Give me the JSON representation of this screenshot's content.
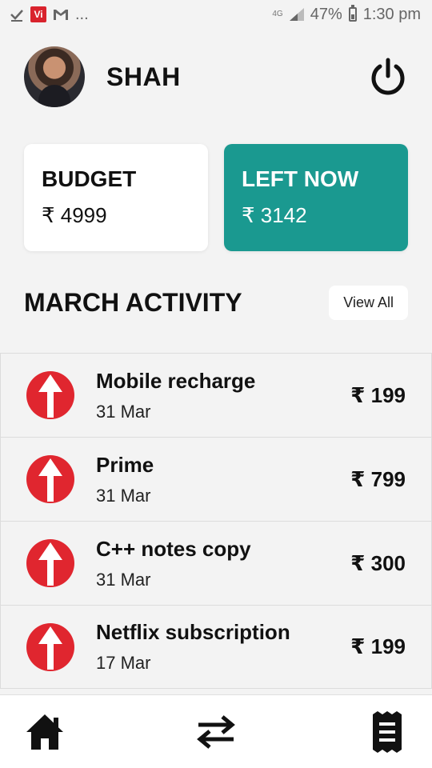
{
  "status_bar": {
    "network": "4G",
    "battery": "47%",
    "time": "1:30 pm",
    "left_icons": [
      "check-icon",
      "vi-icon",
      "gmail-icon",
      "more-dots"
    ],
    "dots": "..."
  },
  "header": {
    "user_name": "SHAH",
    "power_icon": "power-icon"
  },
  "cards": {
    "budget_label": "BUDGET",
    "budget_value": "₹ 4999",
    "left_label": "LEFT NOW",
    "left_value": "₹ 3142"
  },
  "activity": {
    "title": "MARCH ACTIVITY",
    "view_all": "View All",
    "items": [
      {
        "title": "Mobile recharge",
        "date": "31 Mar",
        "amount": "₹ 199"
      },
      {
        "title": "Prime",
        "date": "31 Mar",
        "amount": "₹ 799"
      },
      {
        "title": "C++ notes copy",
        "date": "31 Mar",
        "amount": "₹ 300"
      },
      {
        "title": "Netflix subscription",
        "date": "17 Mar",
        "amount": "₹ 199"
      }
    ]
  },
  "nav": [
    "home-icon",
    "transfer-icon",
    "receipt-icon"
  ],
  "colors": {
    "accent": "#1a9990",
    "expense": "#e0262f",
    "background": "#f3f3f3"
  }
}
